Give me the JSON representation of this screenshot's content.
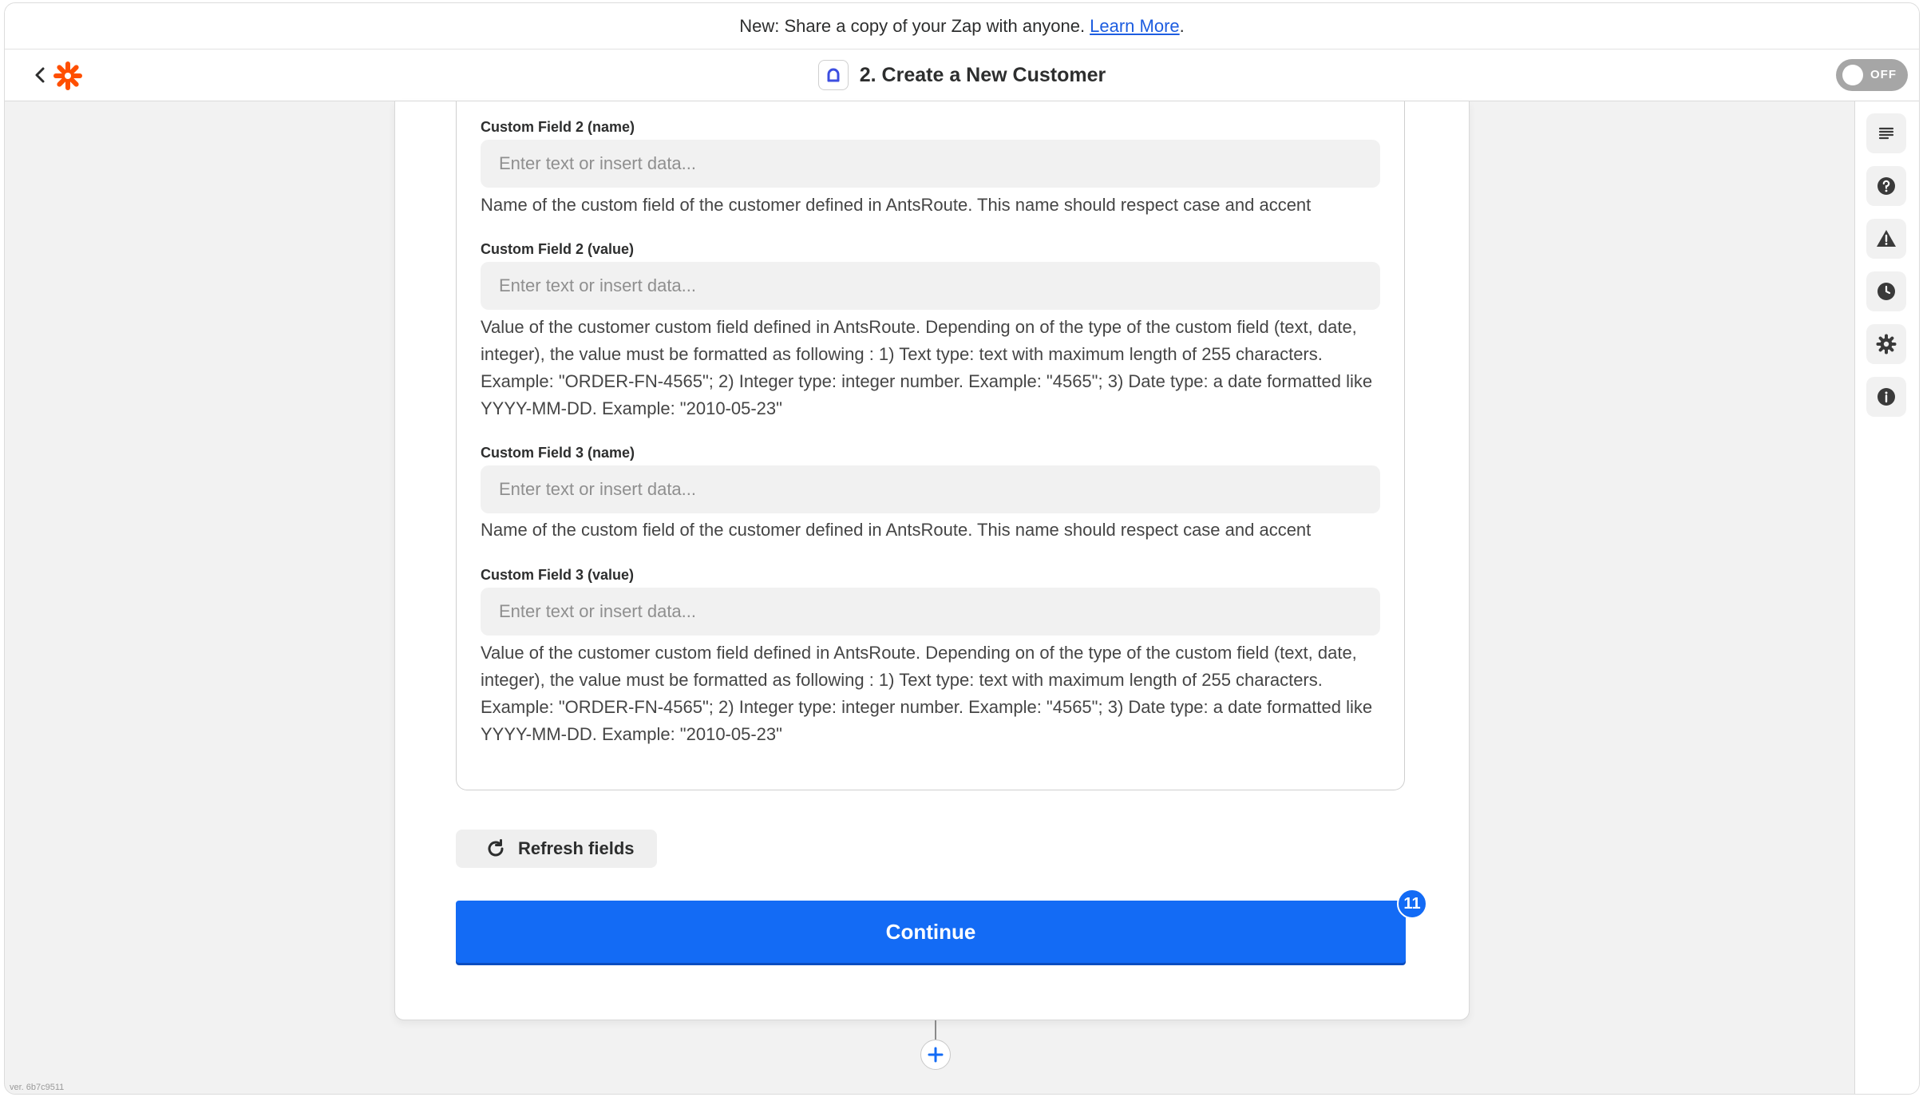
{
  "banner": {
    "text": "New: Share a copy of your Zap with anyone.",
    "link": "Learn More",
    "suffix": "."
  },
  "header": {
    "step_title": "2. Create a New Customer",
    "toggle_label": "OFF"
  },
  "fields": [
    {
      "label": "Custom Field 2 (name)",
      "placeholder": "Enter text or insert data...",
      "help": "Name of the custom field of the customer defined in AntsRoute. This name should respect case and accent"
    },
    {
      "label": "Custom Field 2 (value)",
      "placeholder": "Enter text or insert data...",
      "help": "Value of the customer custom field defined in AntsRoute. Depending on of the type of the custom field (text, date, integer), the value must be formatted as following : 1) Text type: text with maximum length of 255 characters. Example: \"ORDER-FN-4565\"; 2) Integer type: integer number. Example: \"4565\"; 3) Date type: a date formatted like YYYY-MM-DD. Example: \"2010-05-23\""
    },
    {
      "label": "Custom Field 3 (name)",
      "placeholder": "Enter text or insert data...",
      "help": "Name of the custom field of the customer defined in AntsRoute. This name should respect case and accent"
    },
    {
      "label": "Custom Field 3 (value)",
      "placeholder": "Enter text or insert data...",
      "help": "Value of the customer custom field defined in AntsRoute. Depending on of the type of the custom field (text, date, integer), the value must be formatted as following : 1) Text type: text with maximum length of 255 characters. Example: \"ORDER-FN-4565\"; 2) Integer type: integer number. Example: \"4565\"; 3) Date type: a date formatted like YYYY-MM-DD. Example: \"2010-05-23\""
    }
  ],
  "actions": {
    "refresh_label": "Refresh fields",
    "continue_label": "Continue",
    "badge": "11"
  },
  "rail": {
    "icons": [
      "outline-icon",
      "help-icon",
      "warning-icon",
      "history-icon",
      "settings-icon",
      "info-icon"
    ]
  },
  "footer": {
    "version": "ver. 6b7c9511"
  },
  "colors": {
    "accent": "#136bf5",
    "brand": "#ff4f00",
    "link": "#1d5de0"
  }
}
